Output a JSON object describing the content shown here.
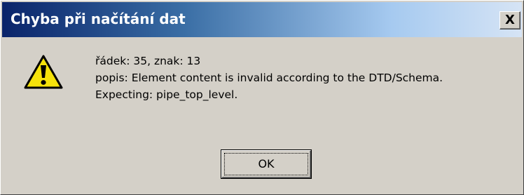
{
  "window": {
    "title": "Chyba při načítání dat",
    "close_label": "X"
  },
  "icon": {
    "name": "warning-icon",
    "fill_color": "#f5e20a",
    "outline_color": "#000000"
  },
  "message": {
    "lines": [
      "řádek: 35, znak: 13",
      "popis: Element content is invalid according to the DTD/Schema.",
      "Expecting: pipe_top_level."
    ]
  },
  "buttons": {
    "ok_label": "OK"
  },
  "colors": {
    "dialog_bg": "#d4d0c8",
    "titlebar_start": "#0a246a",
    "titlebar_end": "#d6e4f5",
    "title_text": "#ffffff"
  }
}
